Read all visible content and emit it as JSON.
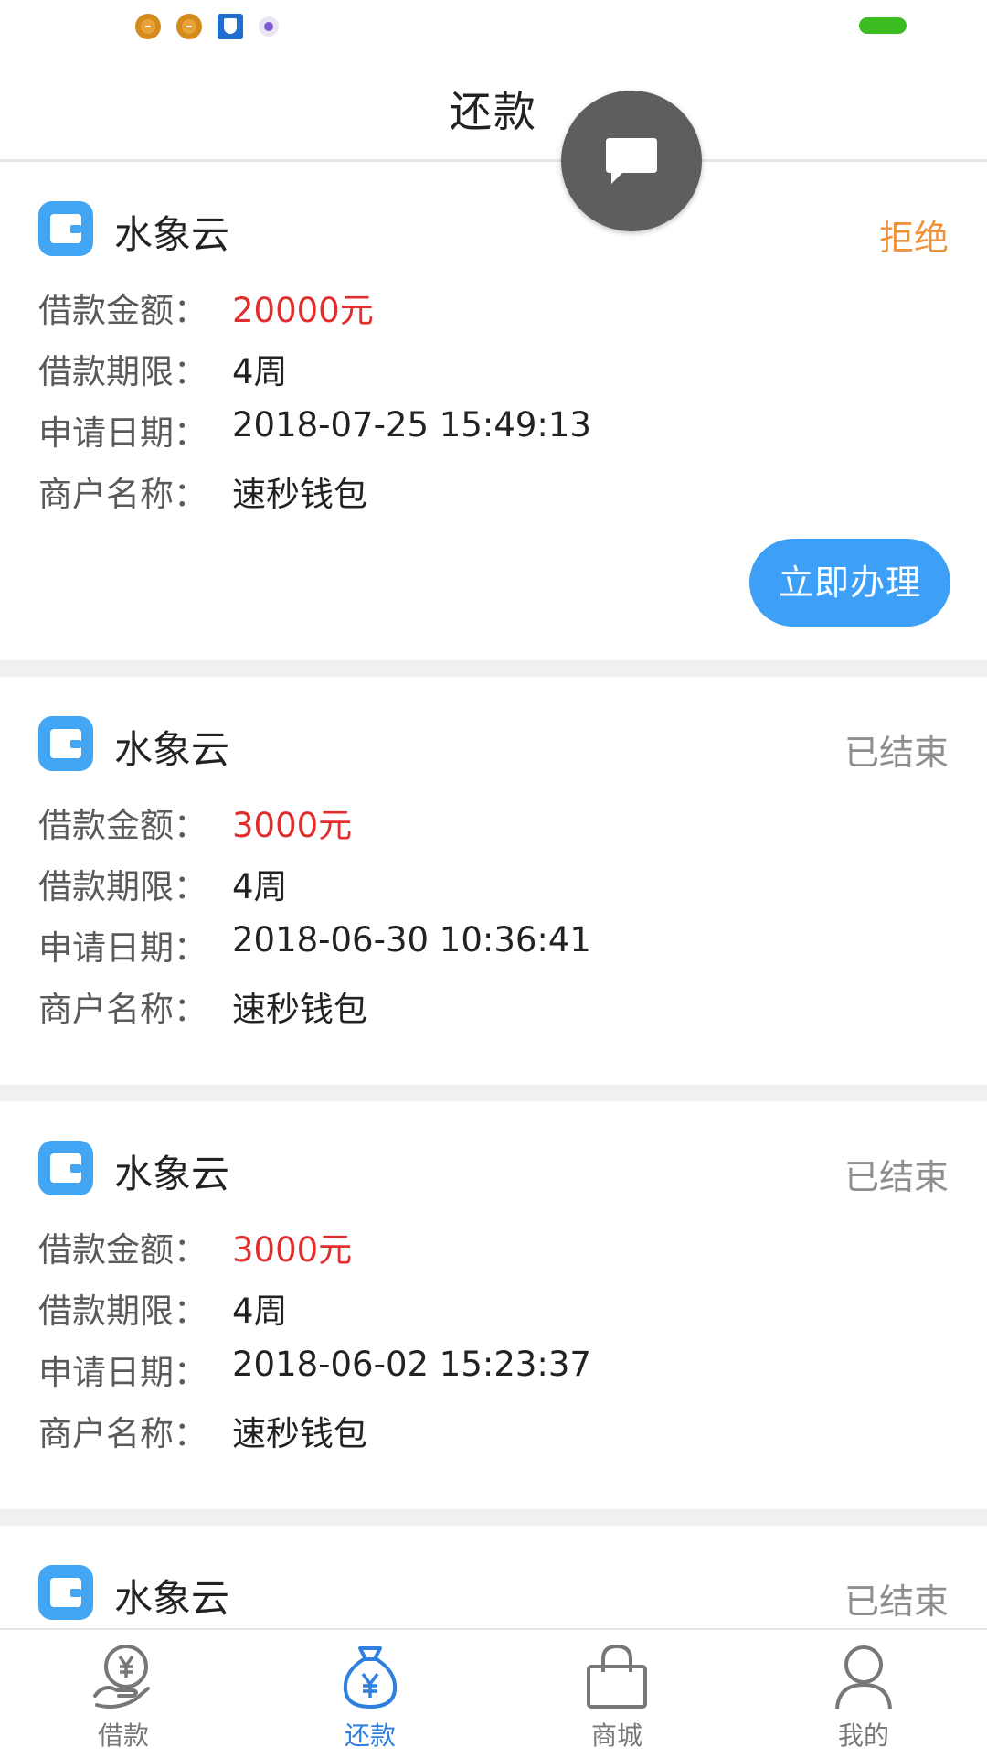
{
  "status_bar": {
    "icons": [
      "orange-ring-icon",
      "orange-ring-icon",
      "blue-shield-icon",
      "purple-dot-icon"
    ],
    "battery_color": "#3bbd1f"
  },
  "header": {
    "title": "还款"
  },
  "fab": {
    "icon": "chat-bubble-icon"
  },
  "labels": {
    "amount": "借款金额：",
    "term": "借款期限：",
    "date": "申请日期：",
    "merchant": "商户名称："
  },
  "loans": [
    {
      "app_name": "水象云",
      "status": "拒绝",
      "amount": "20000元",
      "term": "4周",
      "date": "2018-07-25 15:49:13",
      "merchant": "速秒钱包",
      "action_label": "立即办理"
    },
    {
      "app_name": "水象云",
      "status": "已结束",
      "amount": "3000元",
      "term": "4周",
      "date": "2018-06-30 10:36:41",
      "merchant": "速秒钱包"
    },
    {
      "app_name": "水象云",
      "status": "已结束",
      "amount": "3000元",
      "term": "4周",
      "date": "2018-06-02 15:23:37",
      "merchant": "速秒钱包"
    },
    {
      "app_name": "水象云",
      "status": "已结束"
    }
  ],
  "bottom_nav": [
    {
      "label": "借款",
      "icon": "hand-yen-icon",
      "active": false
    },
    {
      "label": "还款",
      "icon": "money-bag-icon",
      "active": true
    },
    {
      "label": "商城",
      "icon": "shopping-bag-icon",
      "active": false
    },
    {
      "label": "我的",
      "icon": "user-icon",
      "active": false
    }
  ],
  "colors": {
    "accent": "#3d9ff5",
    "amount_red": "#e02e2e",
    "reject_orange": "#f0923a",
    "done_gray": "#8e8e8e",
    "nav_active": "#2e7fe0"
  }
}
